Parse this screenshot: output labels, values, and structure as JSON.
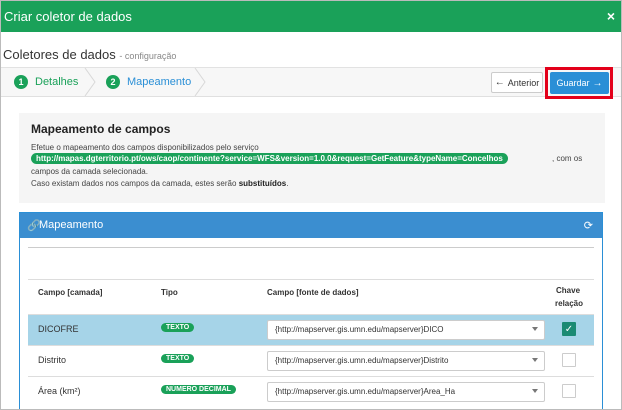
{
  "window": {
    "title": "Criar coletor de dados",
    "close": "×"
  },
  "header": {
    "title": "Coletores de dados",
    "subtitle": "- configuração"
  },
  "wizard": {
    "steps": [
      {
        "number": "1",
        "label": "Detalhes"
      },
      {
        "number": "2",
        "label": "Mapeamento"
      }
    ],
    "prev_label": "Anterior",
    "save_label": "Guardar"
  },
  "info": {
    "title": "Mapeamento de campos",
    "line1": "Efetue o mapeamento dos campos disponibilizados pelo serviço",
    "url": "http://mapas.dgterritorio.pt/ows/caop/continente?service=WFS&version=1.0.0&request=GetFeature&typeName=Concelhos",
    "line1_tail": ", com os",
    "line2": "campos da camada selecionada.",
    "line3": "Caso existam dados nos campos da camada, estes serão",
    "line3_bold": "substituídos",
    "line3_end": "."
  },
  "panel": {
    "title": "Mapeamento",
    "columns": {
      "campo": "Campo [camada]",
      "tipo": "Tipo",
      "fonte": "Campo [fonte de dados]",
      "chave1": "Chave",
      "chave2": "relação"
    },
    "rows": [
      {
        "campo": "DICOFRE",
        "tipo": "TEXTO",
        "fonte": "{http://mapserver.gis.umn.edu/mapserver}DICO",
        "checked": "✓"
      },
      {
        "campo": "Distrito",
        "tipo": "TEXTO",
        "fonte": "{http://mapserver.gis.umn.edu/mapserver}Distrito",
        "checked": ""
      },
      {
        "campo": "Área (km²)",
        "tipo": "NÚMERO DECIMAL",
        "fonte": "{http://mapserver.gis.umn.edu/mapserver}Area_Ha",
        "checked": ""
      }
    ]
  },
  "colors": {
    "green": "#1aa159",
    "blue": "#2a8fd6",
    "highlight": "#e3001a",
    "selected_row": "#a6d4e8"
  }
}
